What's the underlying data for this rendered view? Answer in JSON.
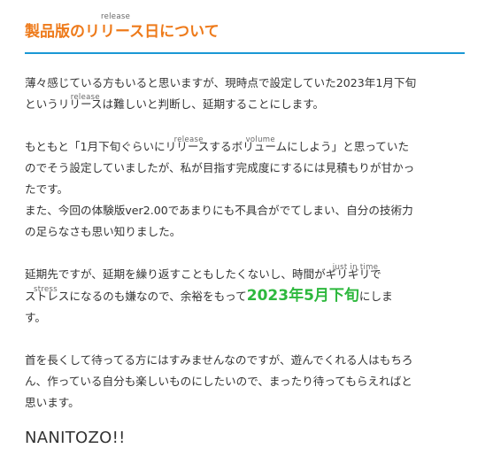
{
  "heading": {
    "text": "製品版のリリース日について",
    "ruby": "release",
    "color": "#ee7a1a",
    "rule_color": "#1a98d5"
  },
  "paragraphs": {
    "p1": {
      "line1": "薄々感じている方もいると思いますが、現時点で設定していた2023年1月下旬",
      "line2_pre": "という",
      "line2_ruby_base": "リリース",
      "line2_ruby": "release",
      "line2_post": "は難しいと判断し、延期することにします。"
    },
    "p2": {
      "line1_pre": "もともと「1月下旬ぐらいに",
      "line1_base1": "リリース",
      "line1_ruby1": "release",
      "line1_mid": "する",
      "line1_base2": "ボリューム",
      "line1_ruby2": "volume",
      "line1_post": "にしよう」と思っていた",
      "line2": "のでそう設定していましたが、私が目指す完成度にするには見積もりが甘かっ",
      "line3": "たです。",
      "line4": "また、今回の体験版ver2.00であまりにも不具合がでてしまい、自分の技術力",
      "line5": "の足らなさも思い知りました。"
    },
    "p3": {
      "line1_pre": "延期先ですが、延期を繰り返すこともしたくないし、時間が",
      "line1_base": "ギリギリ",
      "line1_ruby": "just in time",
      "line1_post": "で",
      "line2_base": "ストレス",
      "line2_ruby": "stress",
      "line2_mid": "になるのも嫌なので、余裕をもって",
      "highlight_date": "2023年5月下旬",
      "line2_post": "にしま",
      "line3": "す。",
      "highlight_color": "#2db83d"
    },
    "p4": {
      "line1": "首を長くして待ってる方にはすみませんなのですが、遊んでくれる人はもちろ",
      "line2": "ん、作っている自分も楽しいものにしたいので、まったり待ってもらえればと",
      "line3": "思います。"
    }
  },
  "closing": "NANITOZO!!"
}
